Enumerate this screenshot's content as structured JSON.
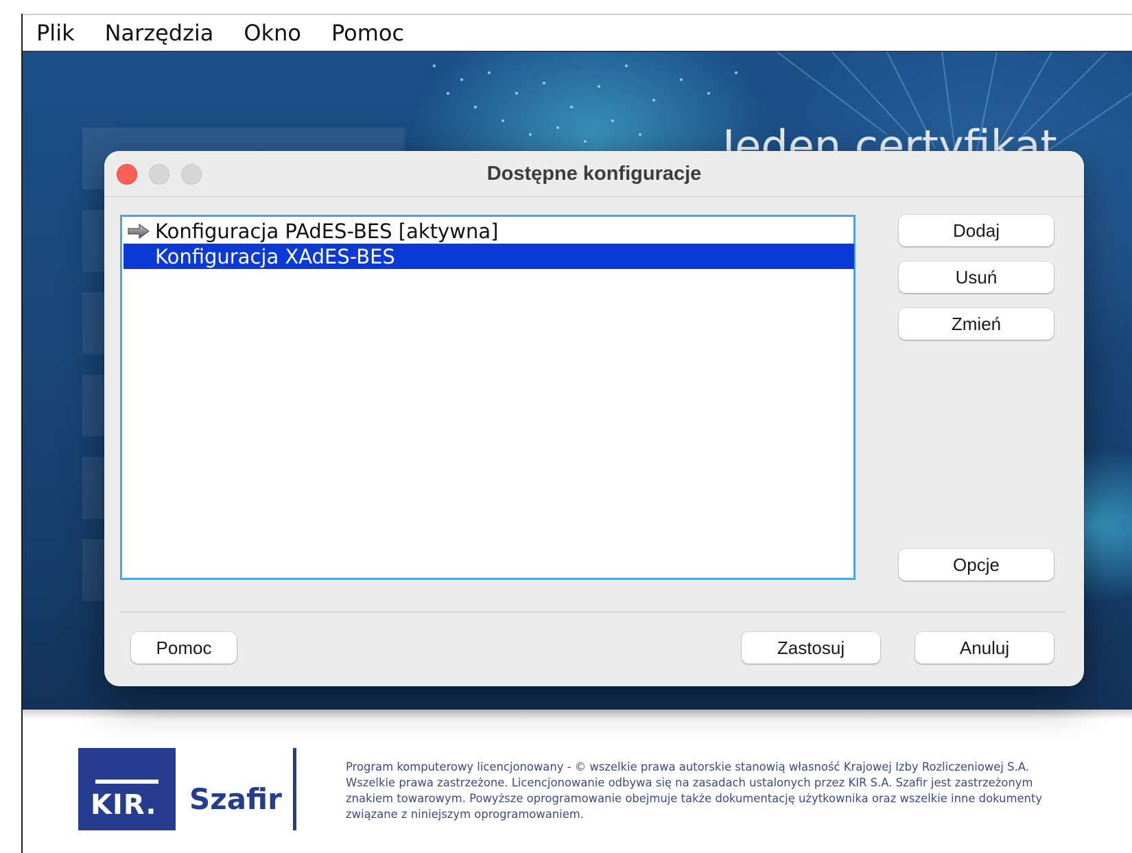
{
  "menubar": {
    "items": [
      "Plik",
      "Narzędzia",
      "Okno",
      "Pomoc"
    ]
  },
  "banner": {
    "slogan_partial": "Jeden certyfikat"
  },
  "dialog": {
    "title": "Dostępne konfiguracje",
    "list": {
      "items": [
        {
          "label": "Konfiguracja PAdES-BES [aktywna]",
          "icon": "arrow-right-icon",
          "active": true,
          "selected": false
        },
        {
          "label": "Konfiguracja XAdES-BES",
          "icon": "",
          "active": false,
          "selected": true
        }
      ]
    },
    "buttons": {
      "add": "Dodaj",
      "remove": "Usuń",
      "edit": "Zmień",
      "options": "Opcje",
      "help": "Pomoc",
      "apply": "Zastosuj",
      "cancel": "Anuluj"
    }
  },
  "footer": {
    "logo_text": "KIR.",
    "product_name": "Szafir",
    "copyright_lines": [
      "Program komputerowy licencjonowany - © wszelkie prawa autorskie stanowią własność Krajowej Izby Rozliczeniowej S.A.",
      "Wszelkie prawa zastrzeżone. Licencjonowanie odbywa się na zasadach ustalonych przez KIR S.A. Szafir jest zastrzeżonym",
      "znakiem towarowym. Powyższe oprogramowanie obejmuje także dokumentację użytkownika oraz wszelkie inne dokumenty",
      "związane z niniejszym oprogramowaniem."
    ]
  },
  "colors": {
    "selection": "#0b3ad6",
    "focus_ring": "#4aa5e6",
    "brand_blue": "#263d8f",
    "close_button": "#fe5f57"
  }
}
